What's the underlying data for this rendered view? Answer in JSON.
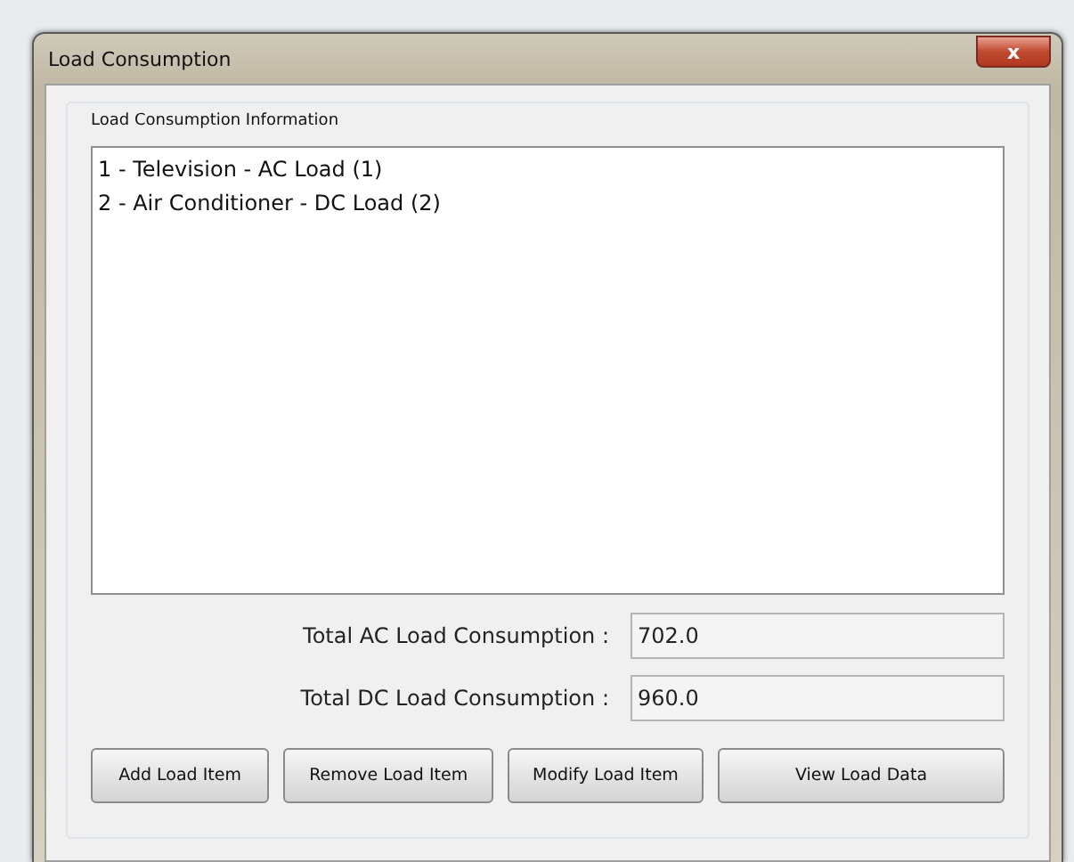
{
  "window": {
    "title": "Load Consumption",
    "close_label": "x"
  },
  "group": {
    "title": "Load Consumption Information"
  },
  "list": {
    "items": [
      {
        "text": "1 - Television - AC Load (1)",
        "selected": false
      },
      {
        "text": "2 - Air Conditioner - DC Load (2)",
        "selected": false
      }
    ]
  },
  "totals": [
    {
      "label": "Total AC Load Consumption :",
      "value": "702.0"
    },
    {
      "label": "Total DC Load Consumption :",
      "value": "960.0"
    }
  ],
  "buttons": [
    "Add Load Item",
    "Remove Load Item",
    "Modify Load Item",
    "View Load Data"
  ]
}
